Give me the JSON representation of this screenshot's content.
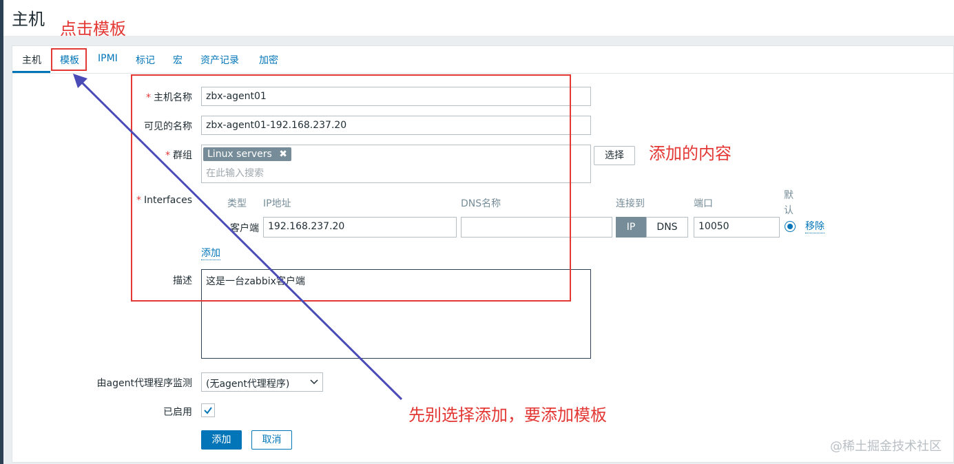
{
  "page": {
    "title": "主机"
  },
  "tabs": [
    {
      "label": "主机",
      "active": true
    },
    {
      "label": "模板"
    },
    {
      "label": "IPMI"
    },
    {
      "label": "标记"
    },
    {
      "label": "宏"
    },
    {
      "label": "资产记录"
    },
    {
      "label": "加密"
    }
  ],
  "form": {
    "host_name": {
      "label": "主机名称",
      "value": "zbx-agent01"
    },
    "visible_name": {
      "label": "可见的名称",
      "value": "zbx-agent01-192.168.237.20"
    },
    "groups": {
      "label": "群组",
      "tag": "Linux servers",
      "tag_remove": "✖",
      "placeholder": "在此输入搜索",
      "select_button": "选择"
    },
    "interfaces": {
      "label": "Interfaces",
      "headers": {
        "type": "类型",
        "ip": "IP地址",
        "dns": "DNS名称",
        "connect_to": "连接到",
        "port": "端口",
        "default": "默认"
      },
      "row": {
        "type": "客户端",
        "ip": "192.168.237.20",
        "dns": "",
        "connect_ip": "IP",
        "connect_dns": "DNS",
        "port": "10050",
        "remove": "移除"
      },
      "add_link": "添加"
    },
    "description": {
      "label": "描述",
      "value": "这是一台zabbix客户端"
    },
    "proxy": {
      "label": "由agent代理程序监测",
      "value": "(无agent代理程序)"
    },
    "enabled": {
      "label": "已启用",
      "checked": true
    },
    "buttons": {
      "add": "添加",
      "cancel": "取消"
    }
  },
  "annotations": {
    "click_template": "点击模板",
    "added_content": "添加的内容",
    "select_first": "先别选择添加，要添加模板"
  },
  "watermark": "@稀土掘金技术社区",
  "colors": {
    "accent": "#0275b8",
    "annotation_red": "#e33734",
    "annotation_arrow": "#4b4bb8",
    "tag_bg": "#768d99"
  }
}
